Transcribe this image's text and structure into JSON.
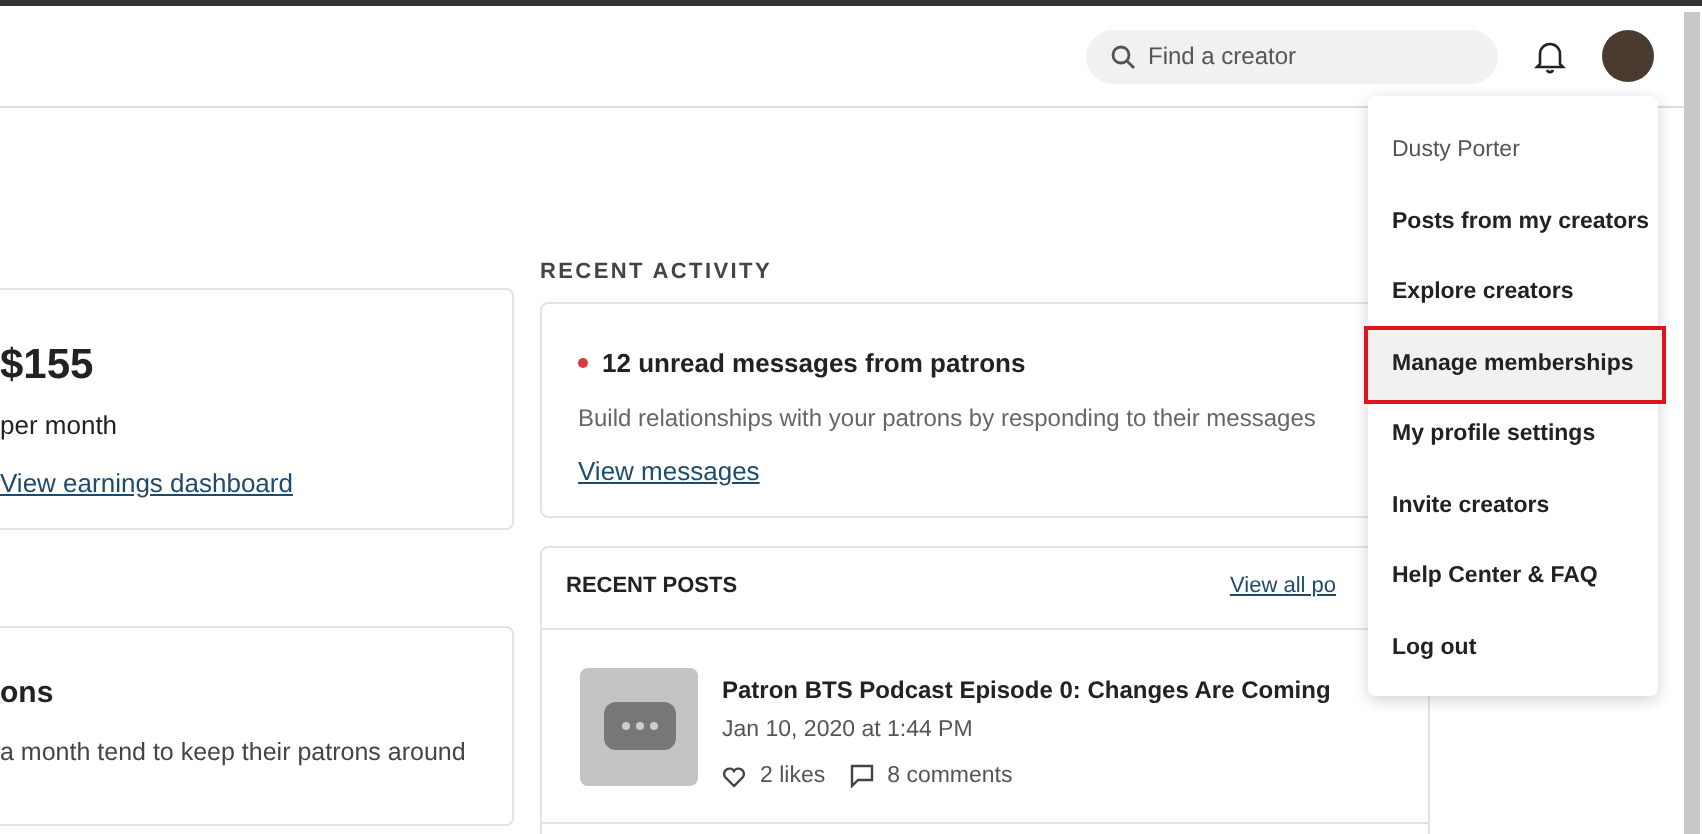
{
  "header": {
    "search": {
      "placeholder": "Find a creator"
    }
  },
  "earnings": {
    "amount": "$155",
    "period": "per month",
    "link": "View earnings dashboard"
  },
  "tip": {
    "title": "ons",
    "text": "a month tend to keep their patrons around"
  },
  "recent_activity": {
    "heading": "RECENT ACTIVITY",
    "title": "12 unread messages from patrons",
    "text": "Build relationships with your patrons by responding to their messages",
    "link": "View messages"
  },
  "recent_posts": {
    "heading": "RECENT POSTS",
    "link": "View all po",
    "posts": [
      {
        "title": "Patron BTS Podcast Episode 0: Changes Are Coming",
        "date": "Jan 10, 2020 at 1:44 PM",
        "likes": "2 likes",
        "comments": "8 comments"
      }
    ]
  },
  "menu": {
    "items": [
      {
        "kind": "name",
        "label": "Dusty Porter",
        "selected": false
      },
      {
        "kind": "link",
        "label": "Posts from my creators",
        "selected": false
      },
      {
        "kind": "link",
        "label": "Explore creators",
        "selected": false
      },
      {
        "kind": "link",
        "label": "Manage memberships",
        "selected": true
      },
      {
        "kind": "link",
        "label": "My profile settings",
        "selected": false
      },
      {
        "kind": "link",
        "label": "Invite creators",
        "selected": false
      },
      {
        "kind": "link",
        "label": "Help Center & FAQ",
        "selected": false
      },
      {
        "kind": "link",
        "label": "Log out",
        "selected": false
      }
    ]
  }
}
